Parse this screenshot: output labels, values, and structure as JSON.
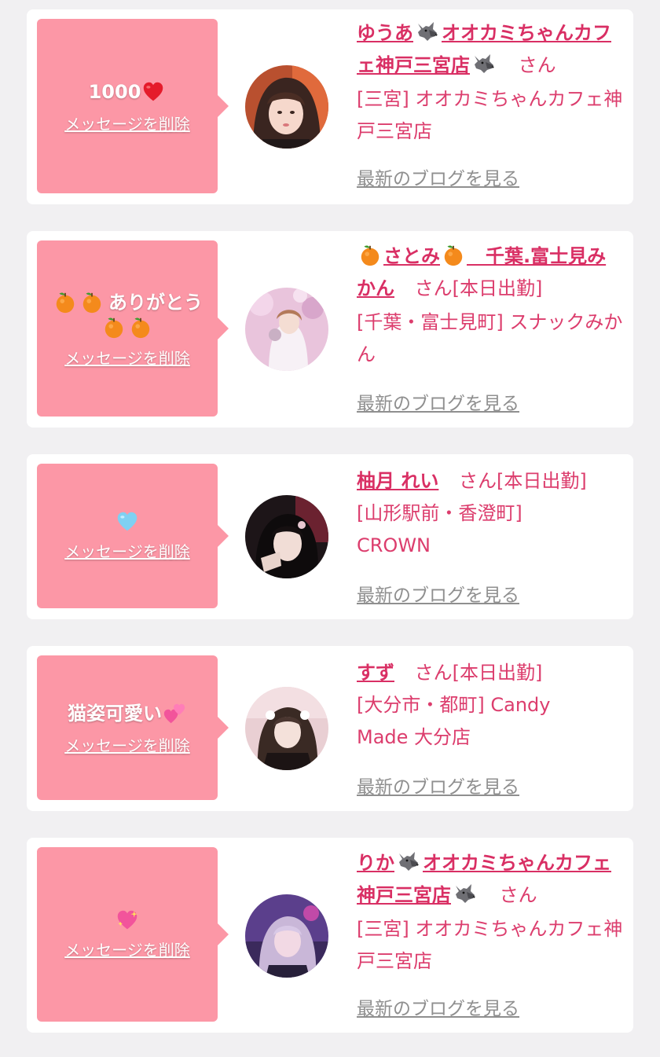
{
  "delete_label": "メッセージを削除",
  "blog_label": "最新のブログを見る",
  "san_label": "さん",
  "colors": {
    "page_bg": "#f1f0f2",
    "bubble": "#fc97a6",
    "name": "#d92f64",
    "info": "#dc3d6d",
    "blog": "#8f8f8f"
  },
  "items": [
    {
      "message": "1000",
      "message_emoji": "heart-red",
      "name_pre": "ゆうあ",
      "name_mid": "オオカミちゃんカフェ神戸三宮店",
      "name_emoji": "wolf-icon",
      "status": "",
      "shop": "[三宮] オオカミちゃんカフェ神戸三宮店"
    },
    {
      "message": "ありがとう",
      "message_emoji": "orange",
      "name_pre": "さとみ",
      "name_mid": "　千葉.富士見みかん",
      "name_emoji": "orange-icon",
      "status": "[本日出勤]",
      "shop": "[千葉・富士見町] スナックみかん"
    },
    {
      "message": "",
      "message_emoji": "heart-blue",
      "name": "柚月 れい",
      "status": "[本日出勤]",
      "shop": "[山形駅前・香澄町] CROWN"
    },
    {
      "message": "猫姿可愛い",
      "message_emoji": "two-hearts",
      "name": "すず",
      "status": "[本日出勤]",
      "shop": "[大分市・都町] Candy Made 大分店"
    },
    {
      "message": "",
      "message_emoji": "sparkling-heart",
      "name_pre": "りか",
      "name_mid": "オオカミちゃんカフェ神戸三宮店",
      "name_emoji": "wolf-icon",
      "status": "",
      "shop": "[三宮] オオカミちゃんカフェ神戸三宮店"
    }
  ]
}
